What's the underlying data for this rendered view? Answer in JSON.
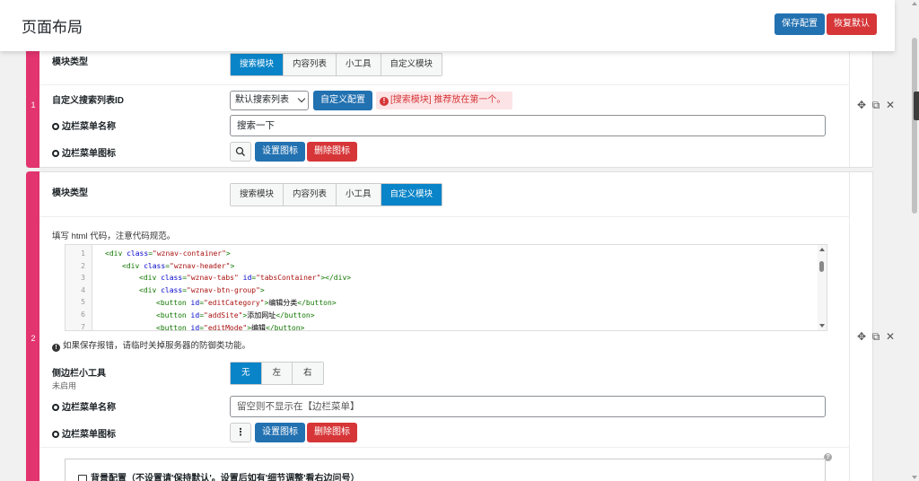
{
  "header": {
    "title": "页面布局",
    "save_label": "保存配置",
    "restore_label": "恢复默认"
  },
  "module1": {
    "number": "1",
    "type_label": "模块类型",
    "type_options": [
      "搜索模块",
      "内容列表",
      "小工具",
      "自定义模块"
    ],
    "type_selected": "搜索模块",
    "search_list_label": "自定义搜索列表ID",
    "search_list_value": "默认搜索列表",
    "custom_config_label": "自定义配置",
    "notice": "[搜索模块] 推荐放在第一个。",
    "menu_name_label": "边栏菜单名称",
    "menu_name_value": "搜索一下",
    "menu_icon_label": "边栏菜单图标",
    "menu_icon_name": "search-icon",
    "set_icon_label": "设置图标",
    "delete_icon_label": "删除图标"
  },
  "module2": {
    "number": "2",
    "type_label": "模块类型",
    "type_options": [
      "搜索模块",
      "内容列表",
      "小工具",
      "自定义模块"
    ],
    "type_selected": "自定义模块",
    "html_hint": "填写 html 代码，注意代码规范。",
    "code_lines": [
      {
        "n": "1",
        "indent": 0,
        "html": "<span class=\"t\">&lt;div</span> <span class=\"a\">class</span>=<span class=\"s\">\"wznav-container\"</span><span class=\"t\">&gt;</span>"
      },
      {
        "n": "2",
        "indent": 1,
        "html": "<span class=\"t\">&lt;div</span> <span class=\"a\">class</span>=<span class=\"s\">\"wznav-header\"</span><span class=\"t\">&gt;</span>"
      },
      {
        "n": "3",
        "indent": 2,
        "html": "<span class=\"t\">&lt;div</span> <span class=\"a\">class</span>=<span class=\"s\">\"wznav-tabs\"</span> <span class=\"a\">id</span>=<span class=\"s\">\"tabsContainer\"</span><span class=\"t\">&gt;&lt;/div&gt;</span>"
      },
      {
        "n": "4",
        "indent": 2,
        "html": "<span class=\"t\">&lt;div</span> <span class=\"a\">class</span>=<span class=\"s\">\"wznav-btn-group\"</span><span class=\"t\">&gt;</span>"
      },
      {
        "n": "5",
        "indent": 3,
        "html": "<span class=\"t\">&lt;button</span> <span class=\"a\">id</span>=<span class=\"s\">\"editCategory\"</span><span class=\"t\">&gt;</span><span class=\"tx\">编辑分类</span><span class=\"t\">&lt;/button&gt;</span>"
      },
      {
        "n": "6",
        "indent": 3,
        "html": "<span class=\"t\">&lt;button</span> <span class=\"a\">id</span>=<span class=\"s\">\"addSite\"</span><span class=\"t\">&gt;</span><span class=\"tx\">添加网址</span><span class=\"t\">&lt;/button&gt;</span>"
      },
      {
        "n": "7",
        "indent": 3,
        "html": "<span class=\"t\">&lt;button</span> <span class=\"a\">id</span>=<span class=\"s\">\"editMode\"</span><span class=\"t\">&gt;</span><span class=\"tx\">编辑</span><span class=\"t\">&lt;/button&gt;</span>"
      }
    ],
    "save_error_info": "如果保存报错，请临时关掉服务器的防御类功能。",
    "sidebar_widget_label": "侧边栏小工具",
    "sidebar_widget_sub": "未启用",
    "widget_options": [
      "无",
      "左",
      "右"
    ],
    "widget_selected": "无",
    "menu_name_label": "边栏菜单名称",
    "menu_name_placeholder": "留空则不显示在【边栏菜单】",
    "menu_icon_label": "边栏菜单图标",
    "menu_icon_name": "vertical-dots-icon",
    "set_icon_label": "设置图标",
    "delete_icon_label": "删除图标",
    "bg_config_title": "背景配置（不设置请'保持默认'。设置后如有'细节调整'看右边问号）"
  },
  "colors": {
    "accent": "#2271b1",
    "danger": "#d63638",
    "stripe": "#e2346f",
    "active_tab": "#0a84c8"
  }
}
